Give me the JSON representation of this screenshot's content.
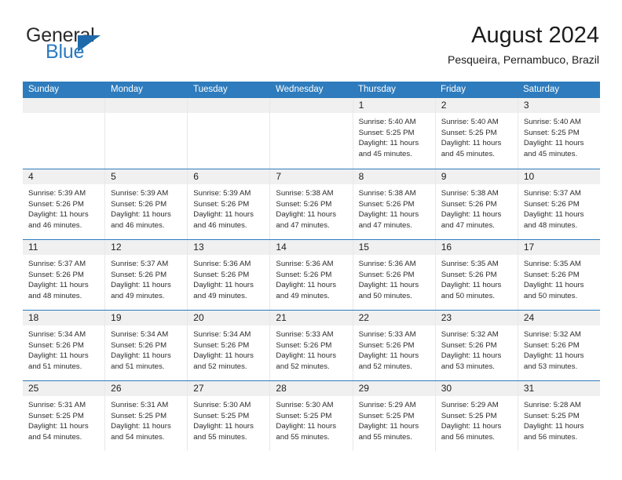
{
  "brand": {
    "name_top": "General",
    "name_bottom": "Blue",
    "triangle_icon": "blue-triangle-logo-mark",
    "accent_color": "#2a7ac0",
    "mark_color": "#1d69ab"
  },
  "header": {
    "title": "August 2024",
    "location": "Pesqueira, Pernambuco, Brazil"
  },
  "calendar": {
    "header_bg": "#2e7cbd",
    "day_band_bg": "#f0f0f0",
    "weekdays": [
      "Sunday",
      "Monday",
      "Tuesday",
      "Wednesday",
      "Thursday",
      "Friday",
      "Saturday"
    ],
    "labels": {
      "sunrise": "Sunrise:",
      "sunset": "Sunset:",
      "daylight": "Daylight:"
    },
    "weeks": [
      [
        {
          "day": "",
          "empty": true
        },
        {
          "day": "",
          "empty": true
        },
        {
          "day": "",
          "empty": true
        },
        {
          "day": "",
          "empty": true
        },
        {
          "day": "1",
          "sunrise": "Sunrise: 5:40 AM",
          "sunset": "Sunset: 5:25 PM",
          "daylight_l1": "Daylight: 11 hours",
          "daylight_l2": "and 45 minutes."
        },
        {
          "day": "2",
          "sunrise": "Sunrise: 5:40 AM",
          "sunset": "Sunset: 5:25 PM",
          "daylight_l1": "Daylight: 11 hours",
          "daylight_l2": "and 45 minutes."
        },
        {
          "day": "3",
          "sunrise": "Sunrise: 5:40 AM",
          "sunset": "Sunset: 5:25 PM",
          "daylight_l1": "Daylight: 11 hours",
          "daylight_l2": "and 45 minutes."
        }
      ],
      [
        {
          "day": "4",
          "sunrise": "Sunrise: 5:39 AM",
          "sunset": "Sunset: 5:26 PM",
          "daylight_l1": "Daylight: 11 hours",
          "daylight_l2": "and 46 minutes."
        },
        {
          "day": "5",
          "sunrise": "Sunrise: 5:39 AM",
          "sunset": "Sunset: 5:26 PM",
          "daylight_l1": "Daylight: 11 hours",
          "daylight_l2": "and 46 minutes."
        },
        {
          "day": "6",
          "sunrise": "Sunrise: 5:39 AM",
          "sunset": "Sunset: 5:26 PM",
          "daylight_l1": "Daylight: 11 hours",
          "daylight_l2": "and 46 minutes."
        },
        {
          "day": "7",
          "sunrise": "Sunrise: 5:38 AM",
          "sunset": "Sunset: 5:26 PM",
          "daylight_l1": "Daylight: 11 hours",
          "daylight_l2": "and 47 minutes."
        },
        {
          "day": "8",
          "sunrise": "Sunrise: 5:38 AM",
          "sunset": "Sunset: 5:26 PM",
          "daylight_l1": "Daylight: 11 hours",
          "daylight_l2": "and 47 minutes."
        },
        {
          "day": "9",
          "sunrise": "Sunrise: 5:38 AM",
          "sunset": "Sunset: 5:26 PM",
          "daylight_l1": "Daylight: 11 hours",
          "daylight_l2": "and 47 minutes."
        },
        {
          "day": "10",
          "sunrise": "Sunrise: 5:37 AM",
          "sunset": "Sunset: 5:26 PM",
          "daylight_l1": "Daylight: 11 hours",
          "daylight_l2": "and 48 minutes."
        }
      ],
      [
        {
          "day": "11",
          "sunrise": "Sunrise: 5:37 AM",
          "sunset": "Sunset: 5:26 PM",
          "daylight_l1": "Daylight: 11 hours",
          "daylight_l2": "and 48 minutes."
        },
        {
          "day": "12",
          "sunrise": "Sunrise: 5:37 AM",
          "sunset": "Sunset: 5:26 PM",
          "daylight_l1": "Daylight: 11 hours",
          "daylight_l2": "and 49 minutes."
        },
        {
          "day": "13",
          "sunrise": "Sunrise: 5:36 AM",
          "sunset": "Sunset: 5:26 PM",
          "daylight_l1": "Daylight: 11 hours",
          "daylight_l2": "and 49 minutes."
        },
        {
          "day": "14",
          "sunrise": "Sunrise: 5:36 AM",
          "sunset": "Sunset: 5:26 PM",
          "daylight_l1": "Daylight: 11 hours",
          "daylight_l2": "and 49 minutes."
        },
        {
          "day": "15",
          "sunrise": "Sunrise: 5:36 AM",
          "sunset": "Sunset: 5:26 PM",
          "daylight_l1": "Daylight: 11 hours",
          "daylight_l2": "and 50 minutes."
        },
        {
          "day": "16",
          "sunrise": "Sunrise: 5:35 AM",
          "sunset": "Sunset: 5:26 PM",
          "daylight_l1": "Daylight: 11 hours",
          "daylight_l2": "and 50 minutes."
        },
        {
          "day": "17",
          "sunrise": "Sunrise: 5:35 AM",
          "sunset": "Sunset: 5:26 PM",
          "daylight_l1": "Daylight: 11 hours",
          "daylight_l2": "and 50 minutes."
        }
      ],
      [
        {
          "day": "18",
          "sunrise": "Sunrise: 5:34 AM",
          "sunset": "Sunset: 5:26 PM",
          "daylight_l1": "Daylight: 11 hours",
          "daylight_l2": "and 51 minutes."
        },
        {
          "day": "19",
          "sunrise": "Sunrise: 5:34 AM",
          "sunset": "Sunset: 5:26 PM",
          "daylight_l1": "Daylight: 11 hours",
          "daylight_l2": "and 51 minutes."
        },
        {
          "day": "20",
          "sunrise": "Sunrise: 5:34 AM",
          "sunset": "Sunset: 5:26 PM",
          "daylight_l1": "Daylight: 11 hours",
          "daylight_l2": "and 52 minutes."
        },
        {
          "day": "21",
          "sunrise": "Sunrise: 5:33 AM",
          "sunset": "Sunset: 5:26 PM",
          "daylight_l1": "Daylight: 11 hours",
          "daylight_l2": "and 52 minutes."
        },
        {
          "day": "22",
          "sunrise": "Sunrise: 5:33 AM",
          "sunset": "Sunset: 5:26 PM",
          "daylight_l1": "Daylight: 11 hours",
          "daylight_l2": "and 52 minutes."
        },
        {
          "day": "23",
          "sunrise": "Sunrise: 5:32 AM",
          "sunset": "Sunset: 5:26 PM",
          "daylight_l1": "Daylight: 11 hours",
          "daylight_l2": "and 53 minutes."
        },
        {
          "day": "24",
          "sunrise": "Sunrise: 5:32 AM",
          "sunset": "Sunset: 5:26 PM",
          "daylight_l1": "Daylight: 11 hours",
          "daylight_l2": "and 53 minutes."
        }
      ],
      [
        {
          "day": "25",
          "sunrise": "Sunrise: 5:31 AM",
          "sunset": "Sunset: 5:25 PM",
          "daylight_l1": "Daylight: 11 hours",
          "daylight_l2": "and 54 minutes."
        },
        {
          "day": "26",
          "sunrise": "Sunrise: 5:31 AM",
          "sunset": "Sunset: 5:25 PM",
          "daylight_l1": "Daylight: 11 hours",
          "daylight_l2": "and 54 minutes."
        },
        {
          "day": "27",
          "sunrise": "Sunrise: 5:30 AM",
          "sunset": "Sunset: 5:25 PM",
          "daylight_l1": "Daylight: 11 hours",
          "daylight_l2": "and 55 minutes."
        },
        {
          "day": "28",
          "sunrise": "Sunrise: 5:30 AM",
          "sunset": "Sunset: 5:25 PM",
          "daylight_l1": "Daylight: 11 hours",
          "daylight_l2": "and 55 minutes."
        },
        {
          "day": "29",
          "sunrise": "Sunrise: 5:29 AM",
          "sunset": "Sunset: 5:25 PM",
          "daylight_l1": "Daylight: 11 hours",
          "daylight_l2": "and 55 minutes."
        },
        {
          "day": "30",
          "sunrise": "Sunrise: 5:29 AM",
          "sunset": "Sunset: 5:25 PM",
          "daylight_l1": "Daylight: 11 hours",
          "daylight_l2": "and 56 minutes."
        },
        {
          "day": "31",
          "sunrise": "Sunrise: 5:28 AM",
          "sunset": "Sunset: 5:25 PM",
          "daylight_l1": "Daylight: 11 hours",
          "daylight_l2": "and 56 minutes."
        }
      ]
    ]
  }
}
